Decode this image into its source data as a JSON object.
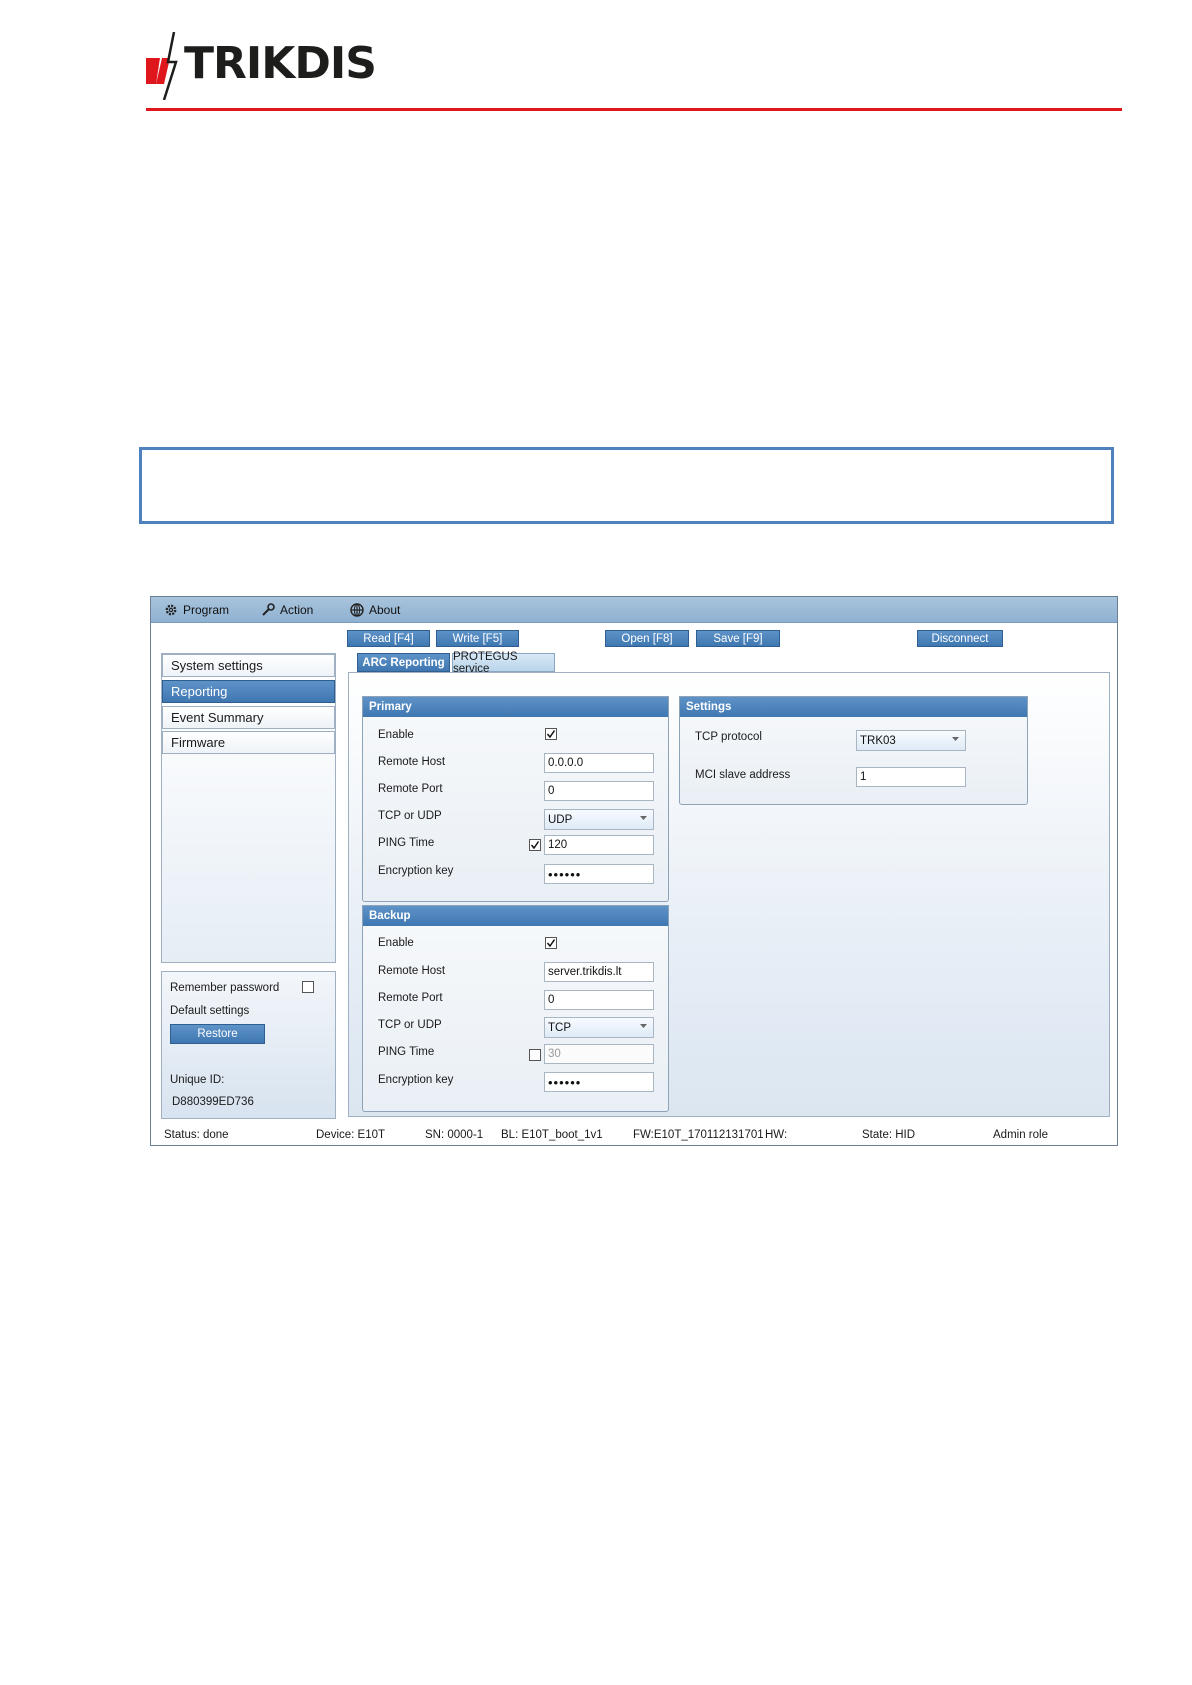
{
  "header": {
    "brand": "TRIKDIS",
    "colors": {
      "accent_red": "#e0161d",
      "app_blue": "#4677b2",
      "box_border": "#4f81bd"
    }
  },
  "menu": {
    "items": [
      {
        "label": "Program",
        "icon": "gear-icon"
      },
      {
        "label": "Action",
        "icon": "wrench-icon"
      },
      {
        "label": "About",
        "icon": "globe-icon"
      }
    ]
  },
  "toolbar": {
    "read": "Read [F4]",
    "write": "Write [F5]",
    "open": "Open [F8]",
    "save": "Save [F9]",
    "disconnect": "Disconnect"
  },
  "nav": {
    "items": [
      "System settings",
      "Reporting",
      "Event Summary",
      "Firmware"
    ],
    "active_index": 1
  },
  "sidebar": {
    "remember_password": "Remember password",
    "remember_checked": false,
    "default_settings": "Default settings",
    "restore": "Restore",
    "unique_id_label": "Unique ID:",
    "unique_id": "D880399ED736"
  },
  "tabs": {
    "items": [
      "ARC Reporting",
      "PROTEGUS service"
    ],
    "active_index": 0
  },
  "primary": {
    "title": "Primary",
    "enable_label": "Enable",
    "enable_checked": true,
    "remote_host_label": "Remote Host",
    "remote_host": "0.0.0.0",
    "remote_port_label": "Remote Port",
    "remote_port": "0",
    "tcp_udp_label": "TCP or UDP",
    "tcp_udp": "UDP",
    "ping_label": "PING Time",
    "ping_checked": true,
    "ping_time": "120",
    "enc_label": "Encryption key",
    "enc_key": "••••••"
  },
  "backup": {
    "title": "Backup",
    "enable_label": "Enable",
    "enable_checked": true,
    "remote_host_label": "Remote Host",
    "remote_host": "server.trikdis.lt",
    "remote_port_label": "Remote Port",
    "remote_port": "0",
    "tcp_udp_label": "TCP or UDP",
    "tcp_udp": "TCP",
    "ping_label": "PING Time",
    "ping_checked": false,
    "ping_time": "30",
    "enc_label": "Encryption key",
    "enc_key": "••••••"
  },
  "settings": {
    "title": "Settings",
    "tcp_protocol_label": "TCP protocol",
    "tcp_protocol": "TRK03",
    "mci_label": "MCI slave address",
    "mci_value": "1"
  },
  "status": {
    "status": "Status:  done",
    "device": "Device:  E10T",
    "sn": "SN: 0000-1",
    "bl": "BL:  E10T_boot_1v1",
    "fw": "FW:E10T_170112131701",
    "hw": "HW:",
    "state": "State:  HID",
    "role": "Admin role"
  }
}
